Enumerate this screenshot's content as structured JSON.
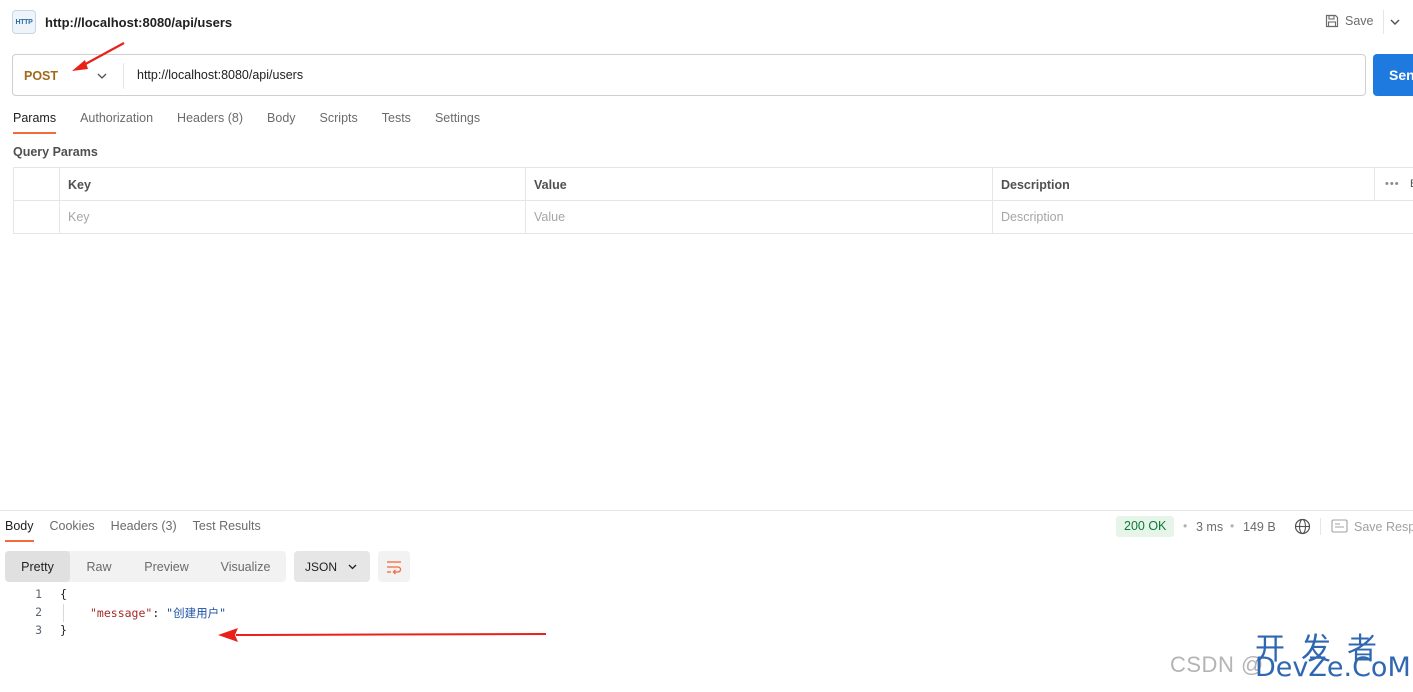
{
  "header": {
    "icon_label": "HTTP",
    "title": "http://localhost:8080/api/users",
    "save_label": "Save"
  },
  "request": {
    "method": "POST",
    "url": "http://localhost:8080/api/users",
    "send_label": "Sen"
  },
  "request_tabs": [
    {
      "label": "Params",
      "active": true
    },
    {
      "label": "Authorization",
      "active": false
    },
    {
      "label": "Headers (8)",
      "active": false
    },
    {
      "label": "Body",
      "active": false
    },
    {
      "label": "Scripts",
      "active": false
    },
    {
      "label": "Tests",
      "active": false
    },
    {
      "label": "Settings",
      "active": false
    }
  ],
  "query_params": {
    "title": "Query Params",
    "columns": [
      "Key",
      "Value",
      "Description"
    ],
    "placeholders": {
      "key": "Key",
      "value": "Value",
      "description": "Description"
    },
    "more_label": "•••",
    "bulk_label": "B"
  },
  "response": {
    "tabs": [
      {
        "label": "Body",
        "active": true
      },
      {
        "label": "Cookies",
        "active": false
      },
      {
        "label": "Headers (3)",
        "active": false
      },
      {
        "label": "Test Results",
        "active": false
      }
    ],
    "status": "200 OK",
    "time": "3 ms",
    "size": "149 B",
    "save_label": "Save Resp",
    "view_modes": [
      {
        "label": "Pretty",
        "active": true
      },
      {
        "label": "Raw",
        "active": false
      },
      {
        "label": "Preview",
        "active": false
      },
      {
        "label": "Visualize",
        "active": false
      }
    ],
    "format": "JSON",
    "body_lines": [
      {
        "num": "1",
        "text": "{"
      },
      {
        "num": "2",
        "key": "\"message\"",
        "colon": ": ",
        "value": "\"创建用户\""
      },
      {
        "num": "3",
        "text": "}"
      }
    ]
  },
  "colors": {
    "accent": "#f26b3a",
    "send": "#1f7ae0",
    "method": "#a16a1a",
    "status_ok": "#0e7a35",
    "annotation_arrow": "#e8221b"
  },
  "watermark": {
    "csdn": "CSDN @",
    "brand_cn": "开发者",
    "brand_en": "DevZe.CoM"
  }
}
